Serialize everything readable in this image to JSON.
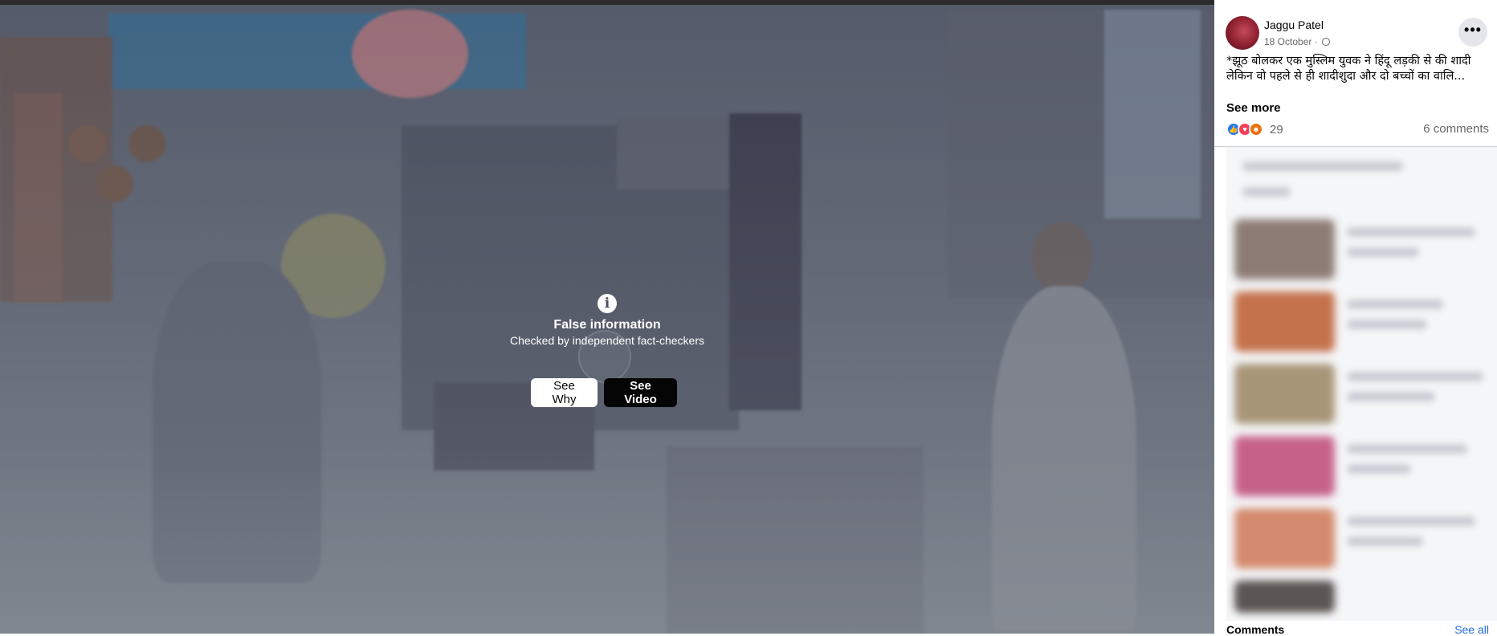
{
  "warning": {
    "title": "False information",
    "subtitle": "Checked by independent fact-checkers",
    "see_why_label": "See Why",
    "see_video_label": "See Video",
    "icon": "info-icon"
  },
  "post": {
    "author": "Jaggu Patel",
    "date": "18 October · ",
    "privacy_icon": "globe-icon",
    "text": "*झूठ बोलकर एक मुस्लिम युवक ने हिंदू लड़की से की शादी लेकिन वो पहले से ही शादीशुदा और दो बच्चों का वालि...",
    "see_more_label": "See more",
    "reaction_icons": [
      "like-icon",
      "love-icon",
      "angry-icon"
    ],
    "reaction_count": "29",
    "comments_count": "6 comments",
    "more_label": "•••"
  },
  "sidebar_footer": {
    "comments_label": "Comments",
    "see_all_label": "See all"
  },
  "colors": {
    "like": "#2078f4",
    "love": "#f33e58",
    "angry": "#e9710f",
    "see_video_bg": "#050505",
    "link": "#216fdb"
  }
}
